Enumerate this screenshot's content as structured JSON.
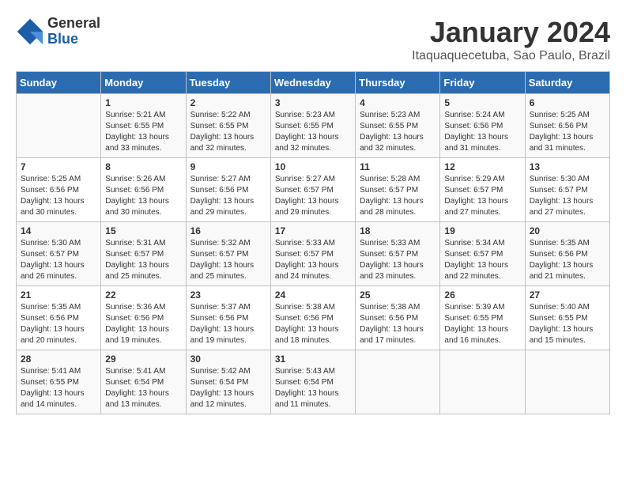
{
  "header": {
    "logo_general": "General",
    "logo_blue": "Blue",
    "month_title": "January 2024",
    "location": "Itaquaquecetuba, Sao Paulo, Brazil"
  },
  "weekdays": [
    "Sunday",
    "Monday",
    "Tuesday",
    "Wednesday",
    "Thursday",
    "Friday",
    "Saturday"
  ],
  "weeks": [
    [
      {
        "day": "",
        "info": ""
      },
      {
        "day": "1",
        "info": "Sunrise: 5:21 AM\nSunset: 6:55 PM\nDaylight: 13 hours\nand 33 minutes."
      },
      {
        "day": "2",
        "info": "Sunrise: 5:22 AM\nSunset: 6:55 PM\nDaylight: 13 hours\nand 32 minutes."
      },
      {
        "day": "3",
        "info": "Sunrise: 5:23 AM\nSunset: 6:55 PM\nDaylight: 13 hours\nand 32 minutes."
      },
      {
        "day": "4",
        "info": "Sunrise: 5:23 AM\nSunset: 6:55 PM\nDaylight: 13 hours\nand 32 minutes."
      },
      {
        "day": "5",
        "info": "Sunrise: 5:24 AM\nSunset: 6:56 PM\nDaylight: 13 hours\nand 31 minutes."
      },
      {
        "day": "6",
        "info": "Sunrise: 5:25 AM\nSunset: 6:56 PM\nDaylight: 13 hours\nand 31 minutes."
      }
    ],
    [
      {
        "day": "7",
        "info": "Sunrise: 5:25 AM\nSunset: 6:56 PM\nDaylight: 13 hours\nand 30 minutes."
      },
      {
        "day": "8",
        "info": "Sunrise: 5:26 AM\nSunset: 6:56 PM\nDaylight: 13 hours\nand 30 minutes."
      },
      {
        "day": "9",
        "info": "Sunrise: 5:27 AM\nSunset: 6:56 PM\nDaylight: 13 hours\nand 29 minutes."
      },
      {
        "day": "10",
        "info": "Sunrise: 5:27 AM\nSunset: 6:57 PM\nDaylight: 13 hours\nand 29 minutes."
      },
      {
        "day": "11",
        "info": "Sunrise: 5:28 AM\nSunset: 6:57 PM\nDaylight: 13 hours\nand 28 minutes."
      },
      {
        "day": "12",
        "info": "Sunrise: 5:29 AM\nSunset: 6:57 PM\nDaylight: 13 hours\nand 27 minutes."
      },
      {
        "day": "13",
        "info": "Sunrise: 5:30 AM\nSunset: 6:57 PM\nDaylight: 13 hours\nand 27 minutes."
      }
    ],
    [
      {
        "day": "14",
        "info": "Sunrise: 5:30 AM\nSunset: 6:57 PM\nDaylight: 13 hours\nand 26 minutes."
      },
      {
        "day": "15",
        "info": "Sunrise: 5:31 AM\nSunset: 6:57 PM\nDaylight: 13 hours\nand 25 minutes."
      },
      {
        "day": "16",
        "info": "Sunrise: 5:32 AM\nSunset: 6:57 PM\nDaylight: 13 hours\nand 25 minutes."
      },
      {
        "day": "17",
        "info": "Sunrise: 5:33 AM\nSunset: 6:57 PM\nDaylight: 13 hours\nand 24 minutes."
      },
      {
        "day": "18",
        "info": "Sunrise: 5:33 AM\nSunset: 6:57 PM\nDaylight: 13 hours\nand 23 minutes."
      },
      {
        "day": "19",
        "info": "Sunrise: 5:34 AM\nSunset: 6:57 PM\nDaylight: 13 hours\nand 22 minutes."
      },
      {
        "day": "20",
        "info": "Sunrise: 5:35 AM\nSunset: 6:56 PM\nDaylight: 13 hours\nand 21 minutes."
      }
    ],
    [
      {
        "day": "21",
        "info": "Sunrise: 5:35 AM\nSunset: 6:56 PM\nDaylight: 13 hours\nand 20 minutes."
      },
      {
        "day": "22",
        "info": "Sunrise: 5:36 AM\nSunset: 6:56 PM\nDaylight: 13 hours\nand 19 minutes."
      },
      {
        "day": "23",
        "info": "Sunrise: 5:37 AM\nSunset: 6:56 PM\nDaylight: 13 hours\nand 19 minutes."
      },
      {
        "day": "24",
        "info": "Sunrise: 5:38 AM\nSunset: 6:56 PM\nDaylight: 13 hours\nand 18 minutes."
      },
      {
        "day": "25",
        "info": "Sunrise: 5:38 AM\nSunset: 6:56 PM\nDaylight: 13 hours\nand 17 minutes."
      },
      {
        "day": "26",
        "info": "Sunrise: 5:39 AM\nSunset: 6:55 PM\nDaylight: 13 hours\nand 16 minutes."
      },
      {
        "day": "27",
        "info": "Sunrise: 5:40 AM\nSunset: 6:55 PM\nDaylight: 13 hours\nand 15 minutes."
      }
    ],
    [
      {
        "day": "28",
        "info": "Sunrise: 5:41 AM\nSunset: 6:55 PM\nDaylight: 13 hours\nand 14 minutes."
      },
      {
        "day": "29",
        "info": "Sunrise: 5:41 AM\nSunset: 6:54 PM\nDaylight: 13 hours\nand 13 minutes."
      },
      {
        "day": "30",
        "info": "Sunrise: 5:42 AM\nSunset: 6:54 PM\nDaylight: 13 hours\nand 12 minutes."
      },
      {
        "day": "31",
        "info": "Sunrise: 5:43 AM\nSunset: 6:54 PM\nDaylight: 13 hours\nand 11 minutes."
      },
      {
        "day": "",
        "info": ""
      },
      {
        "day": "",
        "info": ""
      },
      {
        "day": "",
        "info": ""
      }
    ]
  ]
}
